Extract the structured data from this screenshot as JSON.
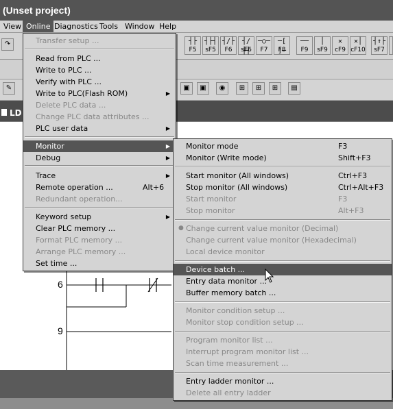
{
  "window": {
    "title": "(Unset project)"
  },
  "menubar": {
    "items": [
      {
        "label": "View",
        "active": false
      },
      {
        "label": "Online",
        "active": true
      },
      {
        "label": "Diagnostics",
        "active": false
      },
      {
        "label": "Tools",
        "active": false
      },
      {
        "label": "Window",
        "active": false
      },
      {
        "label": "Help",
        "active": false
      }
    ]
  },
  "toolbar": {
    "fkeys": [
      {
        "label": "F5",
        "symbol": "┤├"
      },
      {
        "label": "sF5",
        "symbol": "┤├┤"
      },
      {
        "label": "F6",
        "symbol": "┤/├"
      },
      {
        "label": "sF6",
        "symbol": "┤/├┤"
      },
      {
        "label": "F7",
        "symbol": "─○─"
      },
      {
        "label": "F8",
        "symbol": "─[ ]─"
      },
      {
        "label": "F9",
        "symbol": "──"
      },
      {
        "label": "sF9",
        "symbol": "│"
      },
      {
        "label": "cF9",
        "symbol": "✕"
      },
      {
        "label": "cF10",
        "symbol": "✕│"
      },
      {
        "label": "sF7",
        "symbol": "┤↑├"
      }
    ]
  },
  "editor": {
    "tab_label": "LD",
    "step_numbers": [
      "6",
      "9"
    ]
  },
  "online_menu": {
    "items": [
      {
        "label": "Transfer setup ...",
        "disabled": true
      },
      {
        "label": "Read from PLC ...",
        "disabled": false
      },
      {
        "label": "Write to PLC ...",
        "disabled": false
      },
      {
        "label": "Verify with PLC ...",
        "disabled": false
      },
      {
        "label": "Write to PLC(Flash ROM)",
        "disabled": false,
        "submenu": true
      },
      {
        "label": "Delete PLC data ...",
        "disabled": true
      },
      {
        "label": "Change PLC data attributes ...",
        "disabled": true
      },
      {
        "label": "PLC user data",
        "disabled": false,
        "submenu": true
      },
      {
        "label": "Monitor",
        "disabled": false,
        "submenu": true,
        "selected": true
      },
      {
        "label": "Debug",
        "disabled": false,
        "submenu": true
      },
      {
        "label": "Trace",
        "disabled": false,
        "submenu": true
      },
      {
        "label": "Remote operation ...",
        "shortcut": "Alt+6",
        "disabled": false
      },
      {
        "label": "Redundant operation...",
        "disabled": true
      },
      {
        "label": "Keyword setup",
        "disabled": false,
        "submenu": true
      },
      {
        "label": "Clear PLC memory ...",
        "disabled": false
      },
      {
        "label": "Format PLC memory ...",
        "disabled": true
      },
      {
        "label": "Arrange PLC memory ...",
        "disabled": true
      },
      {
        "label": "Set time ...",
        "disabled": false
      }
    ]
  },
  "monitor_menu": {
    "items": [
      {
        "label": "Monitor mode",
        "shortcut": "F3",
        "disabled": false
      },
      {
        "label": "Monitor (Write mode)",
        "shortcut": "Shift+F3",
        "disabled": false
      },
      {
        "label": "Start monitor (All windows)",
        "shortcut": "Ctrl+F3",
        "disabled": false
      },
      {
        "label": "Stop monitor (All windows)",
        "shortcut": "Ctrl+Alt+F3",
        "disabled": false
      },
      {
        "label": "Start monitor",
        "shortcut": "F3",
        "disabled": true
      },
      {
        "label": "Stop monitor",
        "shortcut": "Alt+F3",
        "disabled": true
      },
      {
        "label": "Change current value monitor (Decimal)",
        "disabled": true,
        "bullet": true
      },
      {
        "label": "Change current value monitor (Hexadecimal)",
        "disabled": true
      },
      {
        "label": "Local device monitor",
        "disabled": true
      },
      {
        "label": "Device batch ...",
        "disabled": false,
        "selected": true
      },
      {
        "label": "Entry data monitor ...",
        "disabled": false
      },
      {
        "label": "Buffer memory batch ...",
        "disabled": false
      },
      {
        "label": "Monitor condition setup ...",
        "disabled": true
      },
      {
        "label": "Monitor stop condition setup ...",
        "disabled": true
      },
      {
        "label": "Program monitor list ...",
        "disabled": true
      },
      {
        "label": "Interrupt program monitor list ...",
        "disabled": true
      },
      {
        "label": "Scan time measurement ...",
        "disabled": true
      },
      {
        "label": "Entry ladder monitor ...",
        "disabled": false
      },
      {
        "label": "Delete all entry ladder",
        "disabled": true
      }
    ]
  },
  "colors": {
    "selection": "#555555",
    "menu_bg": "#d4d4d4",
    "title_bg": "#545454"
  }
}
